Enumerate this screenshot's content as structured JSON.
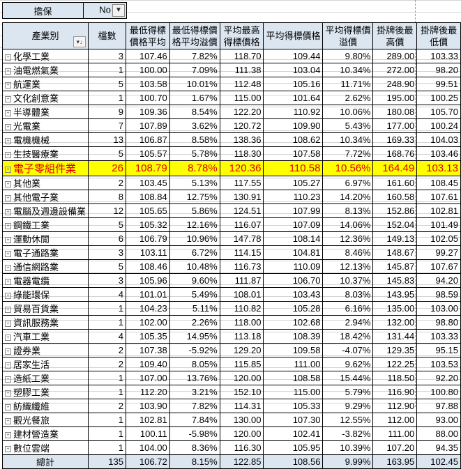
{
  "filter": {
    "label": "擔保",
    "value": "No",
    "icon": "filter-icon"
  },
  "headers": [
    "產業別",
    "檔數",
    "最低得標價格平均",
    "最低得標價格平均溢價",
    "平均最高得標價格",
    "平均得標價格",
    "平均得標價溢價",
    "掛牌後最高價",
    "掛牌後最低價"
  ],
  "header_lines": [
    [
      "產業別"
    ],
    [
      "檔數"
    ],
    [
      "最低得標",
      "價格平均"
    ],
    [
      "最低得標價",
      "格平均溢價"
    ],
    [
      "平均最高",
      "得標價格"
    ],
    [
      "平均得標價格"
    ],
    [
      "平均得標價",
      "溢價"
    ],
    [
      "掛牌後最",
      "高價"
    ],
    [
      "掛牌後最",
      "低價"
    ]
  ],
  "highlight_color": "#ffff00",
  "highlight_text_color": "#e00000",
  "highlight_row": 8,
  "rows": [
    [
      "化學工業",
      "3",
      "107.46",
      "7.82%",
      "118.70",
      "109.44",
      "9.80%",
      "289.00",
      "103.33"
    ],
    [
      "油電燃氣業",
      "1",
      "100.00",
      "7.09%",
      "111.38",
      "103.04",
      "10.34%",
      "272.00",
      "98.20"
    ],
    [
      "航運業",
      "5",
      "103.58",
      "10.01%",
      "112.48",
      "105.16",
      "11.71%",
      "248.90",
      "99.51"
    ],
    [
      "文化創意業",
      "1",
      "100.70",
      "1.67%",
      "115.00",
      "101.64",
      "2.62%",
      "195.00",
      "100.25"
    ],
    [
      "半導體業",
      "9",
      "109.36",
      "8.54%",
      "122.20",
      "110.92",
      "10.06%",
      "180.08",
      "105.70"
    ],
    [
      "光電業",
      "7",
      "107.89",
      "3.62%",
      "120.72",
      "109.90",
      "5.43%",
      "177.00",
      "100.24"
    ],
    [
      "電機機械",
      "13",
      "106.87",
      "8.58%",
      "138.36",
      "108.62",
      "10.34%",
      "169.33",
      "104.03"
    ],
    [
      "生技醫療業",
      "5",
      "105.57",
      "5.78%",
      "118.30",
      "107.58",
      "7.72%",
      "168.76",
      "103.46"
    ],
    [
      "電子零組件業",
      "26",
      "108.79",
      "8.78%",
      "120.36",
      "110.58",
      "10.56%",
      "164.49",
      "103.13"
    ],
    [
      "其他業",
      "2",
      "103.45",
      "5.13%",
      "117.55",
      "105.27",
      "6.97%",
      "161.60",
      "108.45"
    ],
    [
      "其他電子業",
      "8",
      "108.84",
      "12.75%",
      "130.91",
      "110.23",
      "14.20%",
      "160.58",
      "107.61"
    ],
    [
      "電腦及週邊設備業",
      "12",
      "105.65",
      "5.86%",
      "124.51",
      "107.99",
      "8.13%",
      "152.86",
      "102.81"
    ],
    [
      "鋼鐵工業",
      "5",
      "105.32",
      "12.16%",
      "116.07",
      "107.09",
      "14.06%",
      "152.04",
      "101.49"
    ],
    [
      "運動休閒",
      "6",
      "106.79",
      "10.96%",
      "147.78",
      "108.14",
      "12.36%",
      "149.13",
      "102.05"
    ],
    [
      "電子通路業",
      "3",
      "103.11",
      "6.72%",
      "114.15",
      "104.81",
      "8.46%",
      "148.67",
      "99.27"
    ],
    [
      "通信網路業",
      "5",
      "108.46",
      "10.48%",
      "116.73",
      "110.09",
      "12.13%",
      "145.87",
      "107.67"
    ],
    [
      "電器電纜",
      "3",
      "105.96",
      "9.60%",
      "111.87",
      "106.70",
      "10.37%",
      "145.83",
      "94.20"
    ],
    [
      "綠能環保",
      "4",
      "101.01",
      "5.49%",
      "108.01",
      "103.43",
      "8.03%",
      "143.95",
      "98.59"
    ],
    [
      "貿易百貨業",
      "1",
      "104.23",
      "5.11%",
      "110.82",
      "105.28",
      "6.16%",
      "135.00",
      "103.00"
    ],
    [
      "資訊服務業",
      "1",
      "102.00",
      "2.26%",
      "118.00",
      "102.68",
      "2.94%",
      "132.00",
      "98.80"
    ],
    [
      "汽車工業",
      "4",
      "105.35",
      "14.95%",
      "113.18",
      "108.39",
      "18.42%",
      "131.44",
      "103.33"
    ],
    [
      "證券業",
      "2",
      "107.38",
      "-5.92%",
      "129.20",
      "109.58",
      "-4.07%",
      "129.35",
      "95.15"
    ],
    [
      "居家生活",
      "2",
      "109.40",
      "8.05%",
      "115.85",
      "111.00",
      "9.62%",
      "122.25",
      "103.53"
    ],
    [
      "造紙工業",
      "1",
      "107.00",
      "13.76%",
      "120.00",
      "108.58",
      "15.44%",
      "118.50",
      "92.20"
    ],
    [
      "塑膠工業",
      "1",
      "112.20",
      "3.21%",
      "152.10",
      "115.00",
      "5.79%",
      "116.90",
      "100.80"
    ],
    [
      "紡織纖維",
      "2",
      "103.90",
      "7.82%",
      "114.31",
      "105.33",
      "9.29%",
      "112.90",
      "97.88"
    ],
    [
      "觀光餐旅",
      "1",
      "102.81",
      "7.84%",
      "130.00",
      "107.30",
      "12.55%",
      "112.00",
      "93.00"
    ],
    [
      "建材營造業",
      "1",
      "100.11",
      "-5.98%",
      "120.00",
      "102.41",
      "-3.82%",
      "111.00",
      "88.00"
    ],
    [
      "數位雲端",
      "1",
      "104.00",
      "8.36%",
      "116.30",
      "105.95",
      "10.39%",
      "107.20",
      "94.35"
    ]
  ],
  "total": [
    "總計",
    "135",
    "106.72",
    "8.15%",
    "122.85",
    "108.56",
    "9.99%",
    "163.95",
    "102.45"
  ]
}
